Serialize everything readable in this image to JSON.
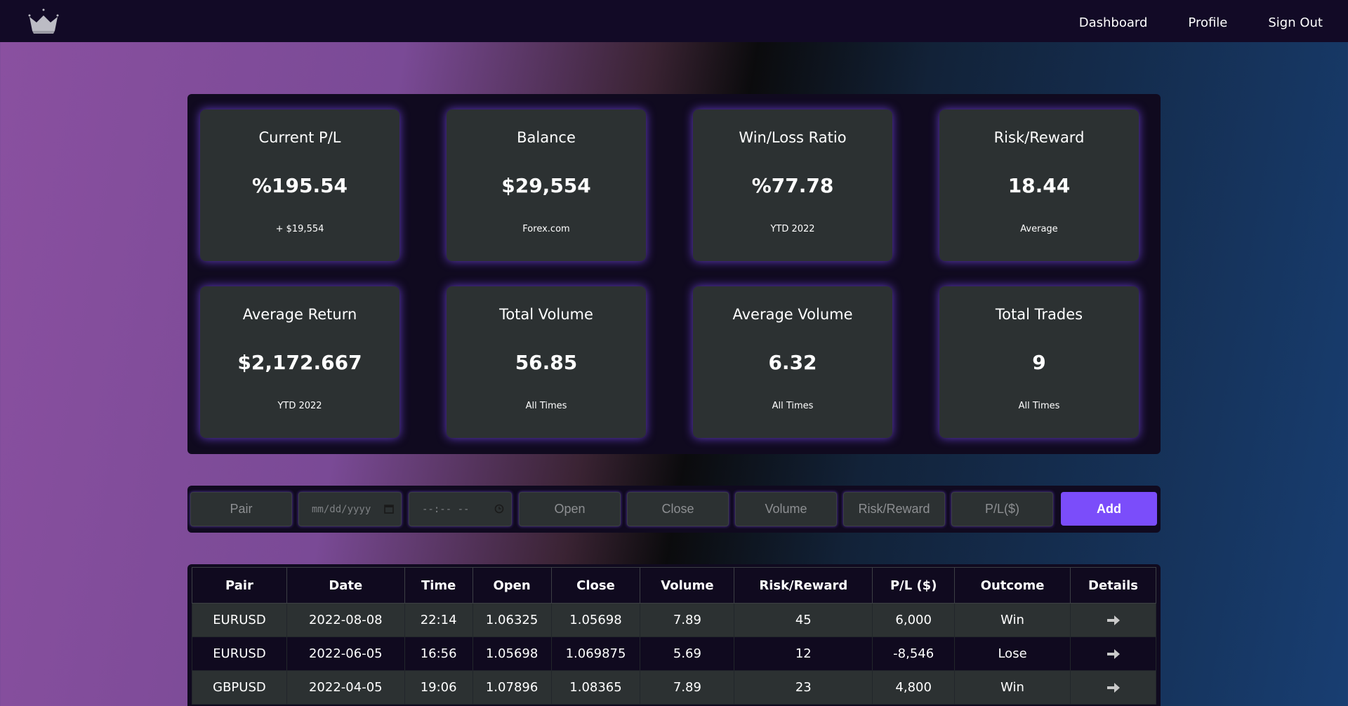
{
  "nav": {
    "logo": "crown-logo-icon",
    "links": [
      "Dashboard",
      "Profile",
      "Sign Out"
    ]
  },
  "stats": [
    {
      "title": "Current P/L",
      "value": "%195.54",
      "sub": "+ $19,554"
    },
    {
      "title": "Balance",
      "value": "$29,554",
      "sub": "Forex.com"
    },
    {
      "title": "Win/Loss Ratio",
      "value": "%77.78",
      "sub": "YTD 2022"
    },
    {
      "title": "Risk/Reward",
      "value": "18.44",
      "sub": "Average"
    },
    {
      "title": "Average Return",
      "value": "$2,172.667",
      "sub": "YTD 2022"
    },
    {
      "title": "Total Volume",
      "value": "56.85",
      "sub": "All Times"
    },
    {
      "title": "Average Volume",
      "value": "6.32",
      "sub": "All Times"
    },
    {
      "title": "Total Trades",
      "value": "9",
      "sub": "All Times"
    }
  ],
  "form": {
    "pair_placeholder": "Pair",
    "date_placeholder": "mm/dd/yyyy",
    "time_placeholder": "--:-- --",
    "open_placeholder": "Open",
    "close_placeholder": "Close",
    "volume_placeholder": "Volume",
    "risk_reward_placeholder": "Risk/Reward",
    "pl_placeholder": "P/L($)",
    "add_label": "Add"
  },
  "table": {
    "headers": [
      "Pair",
      "Date",
      "Time",
      "Open",
      "Close",
      "Volume",
      "Risk/Reward",
      "P/L ($)",
      "Outcome",
      "Details"
    ],
    "rows": [
      [
        "EURUSD",
        "2022-08-08",
        "22:14",
        "1.06325",
        "1.05698",
        "7.89",
        "45",
        "6,000",
        "Win"
      ],
      [
        "EURUSD",
        "2022-06-05",
        "16:56",
        "1.05698",
        "1.069875",
        "5.69",
        "12",
        "-8,546",
        "Lose"
      ],
      [
        "GBPUSD",
        "2022-04-05",
        "19:06",
        "1.07896",
        "1.08365",
        "7.89",
        "23",
        "4,800",
        "Win"
      ]
    ],
    "details_icon": "arrow-right-icon"
  },
  "colors": {
    "accent": "#7b4dfa",
    "panel": "#100a1f",
    "card": "#2c3132",
    "navbar": "#120a26"
  }
}
